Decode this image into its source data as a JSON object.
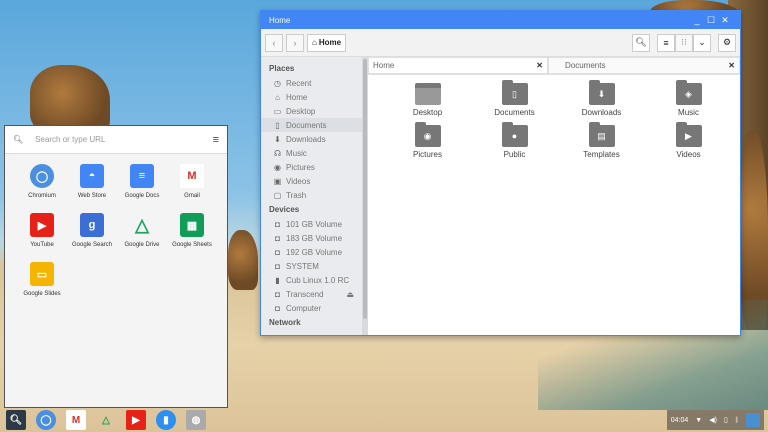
{
  "file_manager": {
    "title": "Home",
    "window_controls": [
      "minimize",
      "maximize",
      "close"
    ],
    "toolbar": {
      "back": "back-icon",
      "forward": "forward-icon",
      "location": "Home"
    },
    "sidebar": {
      "places_header": "Places",
      "places": [
        {
          "label": "Recent",
          "icon": "clock"
        },
        {
          "label": "Home",
          "icon": "home"
        },
        {
          "label": "Desktop",
          "icon": "desktop"
        },
        {
          "label": "Documents",
          "icon": "document",
          "selected": true
        },
        {
          "label": "Downloads",
          "icon": "download"
        },
        {
          "label": "Music",
          "icon": "headphones"
        },
        {
          "label": "Pictures",
          "icon": "camera"
        },
        {
          "label": "Videos",
          "icon": "video"
        },
        {
          "label": "Trash",
          "icon": "trash"
        }
      ],
      "devices_header": "Devices",
      "devices": [
        {
          "label": "101 GB Volume"
        },
        {
          "label": "183 GB Volume"
        },
        {
          "label": "192 GB Volume"
        },
        {
          "label": "SYSTEM"
        },
        {
          "label": "Cub Linux 1.0 RC"
        },
        {
          "label": "Transcend",
          "eject": true
        },
        {
          "label": "Computer"
        }
      ],
      "network_header": "Network"
    },
    "tabs": [
      {
        "label": "Home",
        "active": true
      },
      {
        "label": "Documents",
        "active": false
      }
    ],
    "folders": [
      {
        "label": "Desktop",
        "icon": "desktop"
      },
      {
        "label": "Documents",
        "icon": "document"
      },
      {
        "label": "Downloads",
        "icon": "download"
      },
      {
        "label": "Music",
        "icon": "music"
      },
      {
        "label": "Pictures",
        "icon": "camera"
      },
      {
        "label": "Public",
        "icon": "person"
      },
      {
        "label": "Templates",
        "icon": "template"
      },
      {
        "label": "Videos",
        "icon": "play"
      }
    ]
  },
  "launcher": {
    "search_placeholder": "Search or type URL",
    "apps": [
      {
        "label": "Chromium",
        "color": "#4a8fe0"
      },
      {
        "label": "Web Store",
        "color": "#4285f4"
      },
      {
        "label": "Google Docs",
        "color": "#4285f4"
      },
      {
        "label": "Gmail",
        "color": "#d93025"
      },
      {
        "label": "YouTube",
        "color": "#e62117"
      },
      {
        "label": "Google Search",
        "color": "#3b6fd6"
      },
      {
        "label": "Google Drive",
        "color": "#1fa463"
      },
      {
        "label": "Google Sheets",
        "color": "#0f9d58"
      },
      {
        "label": "Google Slides",
        "color": "#f4b400"
      }
    ]
  },
  "shelf": {
    "apps": [
      "launcher-search",
      "chromium",
      "gmail",
      "google-drive",
      "youtube",
      "files",
      "software-center"
    ],
    "clock": "04:04"
  }
}
